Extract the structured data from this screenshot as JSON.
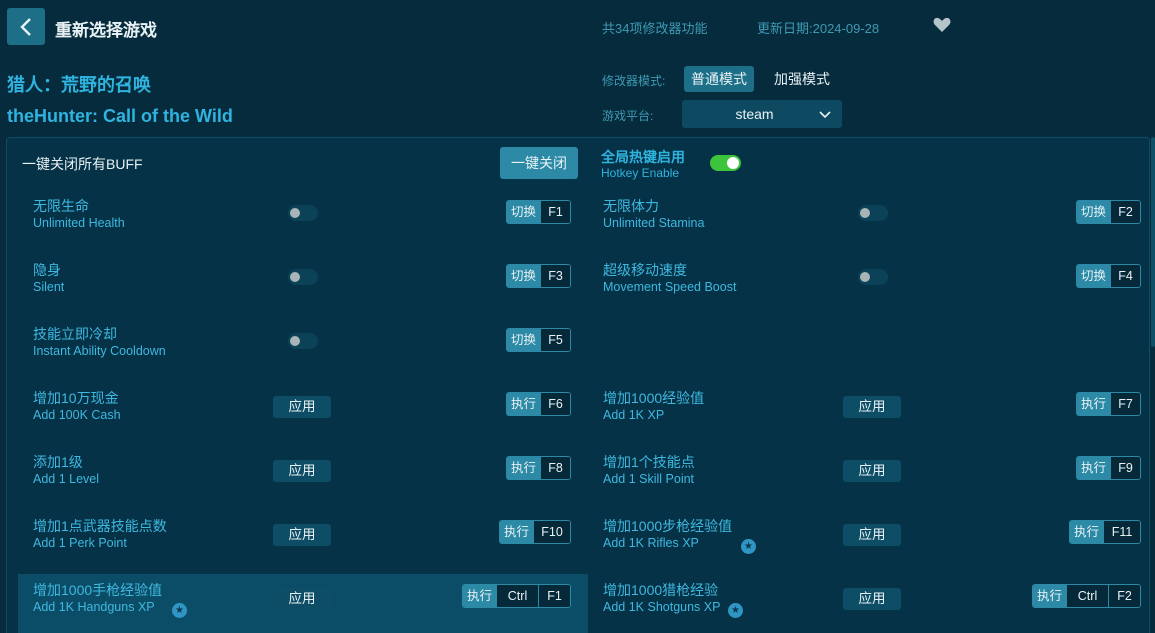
{
  "header": {
    "back_label": "back",
    "title": "重新选择游戏",
    "feature_count": "共34项修改器功能",
    "update_date": "更新日期:2024-09-28"
  },
  "game": {
    "name_cn": "猎人：荒野的召唤",
    "name_en": "theHunter: Call of the Wild"
  },
  "mode": {
    "label": "修改器模式:",
    "options": [
      "普通模式",
      "加强模式"
    ],
    "selected": "普通模式"
  },
  "platform": {
    "label": "游戏平台:",
    "value": "steam"
  },
  "toolbar": {
    "buff_label": "一键关闭所有BUFF",
    "close_all_label": "一键关闭",
    "hotkey_title": "全局热键启用",
    "hotkey_subtitle": "Hotkey Enable",
    "hotkey_enabled": true
  },
  "colors": {
    "background": "#062b3c",
    "accent": "#2fb3df",
    "button": "#2c8aa6",
    "toggle_on": "#3cc43c"
  },
  "items": [
    {
      "cn": "无限生命",
      "en": "Unlimited Health",
      "control": "toggle",
      "on": false,
      "key_label": "切换",
      "keys": [
        "F1"
      ]
    },
    {
      "cn": "无限体力",
      "en": "Unlimited Stamina",
      "control": "toggle",
      "on": false,
      "key_label": "切换",
      "keys": [
        "F2"
      ]
    },
    {
      "cn": "隐身",
      "en": "Silent",
      "control": "toggle",
      "on": false,
      "key_label": "切换",
      "keys": [
        "F3"
      ]
    },
    {
      "cn": "超级移动速度",
      "en": "Movement Speed Boost",
      "control": "toggle",
      "on": false,
      "key_label": "切换",
      "keys": [
        "F4"
      ]
    },
    {
      "cn": "技能立即冷却",
      "en": "Instant Ability Cooldown",
      "control": "toggle",
      "on": false,
      "key_label": "切换",
      "keys": [
        "F5"
      ]
    },
    {
      "cn": "增加10万现金",
      "en": "Add 100K Cash",
      "control": "apply",
      "apply_label": "应用",
      "key_label": "执行",
      "keys": [
        "F6"
      ]
    },
    {
      "cn": "增加1000经验值",
      "en": "Add 1K XP",
      "control": "apply",
      "apply_label": "应用",
      "key_label": "执行",
      "keys": [
        "F7"
      ]
    },
    {
      "cn": "添加1级",
      "en": "Add 1 Level",
      "control": "apply",
      "apply_label": "应用",
      "key_label": "执行",
      "keys": [
        "F8"
      ]
    },
    {
      "cn": "增加1个技能点",
      "en": "Add 1 Skill Point",
      "control": "apply",
      "apply_label": "应用",
      "key_label": "执行",
      "keys": [
        "F9"
      ]
    },
    {
      "cn": "增加1点武器技能点数",
      "en": "Add 1 Perk Point",
      "control": "apply",
      "apply_label": "应用",
      "key_label": "执行",
      "keys": [
        "F10"
      ]
    },
    {
      "cn": "增加1000步枪经验值",
      "en": "Add 1K Rifles XP",
      "control": "apply",
      "starred": true,
      "apply_label": "应用",
      "key_label": "执行",
      "keys": [
        "F11"
      ]
    },
    {
      "cn": "增加1000手枪经验值",
      "en": "Add 1K Handguns XP",
      "control": "apply",
      "starred": true,
      "highlighted": true,
      "apply_label": "应用",
      "key_label": "执行",
      "keys": [
        "Ctrl",
        "F1"
      ]
    },
    {
      "cn": "增加1000猎枪经验",
      "en": "Add 1K Shotguns XP",
      "control": "apply",
      "starred": true,
      "apply_label": "应用",
      "key_label": "执行",
      "keys": [
        "Ctrl",
        "F2"
      ]
    }
  ]
}
